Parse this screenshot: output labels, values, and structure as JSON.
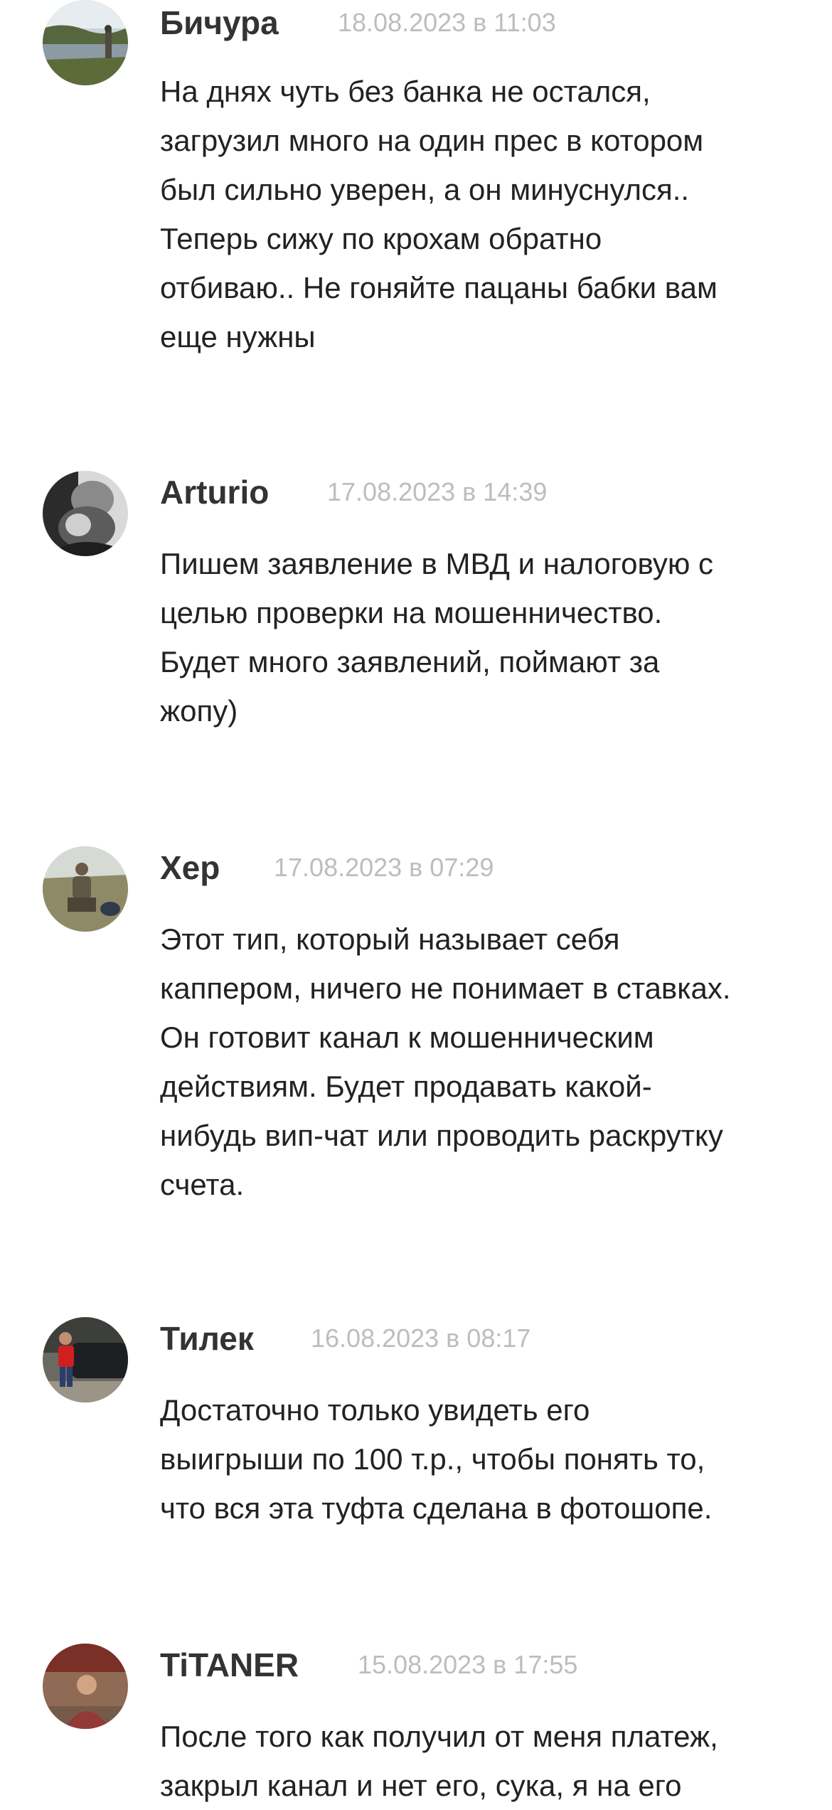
{
  "comments": [
    {
      "author": "Бичура",
      "date": "18.08.2023 в 11:03",
      "text": "На днях чуть без банка не остался,\nзагрузил много на один прес в котором\nбыл сильно уверен, а он минуснулся..\nТеперь сижу по крохам обратно\nотбиваю.. Не гоняйте пацаны бабки вам\nеще нужны",
      "avatar": "avatar-landscape-river"
    },
    {
      "author": "Arturio",
      "date": "17.08.2023 в 14:39",
      "text": "Пишем заявление в МВД и налоговую с\nцелью проверки на мошенничество.\nБудет много заявлений, поймают за\nжопу)",
      "avatar": "avatar-bw-portrait"
    },
    {
      "author": "Хер",
      "date": "17.08.2023 в 07:29",
      "text": "Этот тип, который называет себя\nкаппером, ничего не понимает в ставках.\nОн готовит канал к мошенническим\nдействиям. Будет продавать какой-\nнибудь вип-чат или проводить раскрутку\nсчета.",
      "avatar": "avatar-hunter-outdoor"
    },
    {
      "author": "Тилек",
      "date": "16.08.2023 в 08:17",
      "text": "Достаточно только увидеть его\nвыигрыши по 100 т.р., чтобы понять то,\nчто вся эта туфта сделана в фотошопе.",
      "avatar": "avatar-man-red-jacket-car"
    },
    {
      "author": "TiTANER",
      "date": "15.08.2023 в 17:55",
      "text": "После того как получил от меня платеж,\nзакрыл канал и нет его, сука, я на его",
      "avatar": "avatar-man-red-shirt"
    }
  ]
}
